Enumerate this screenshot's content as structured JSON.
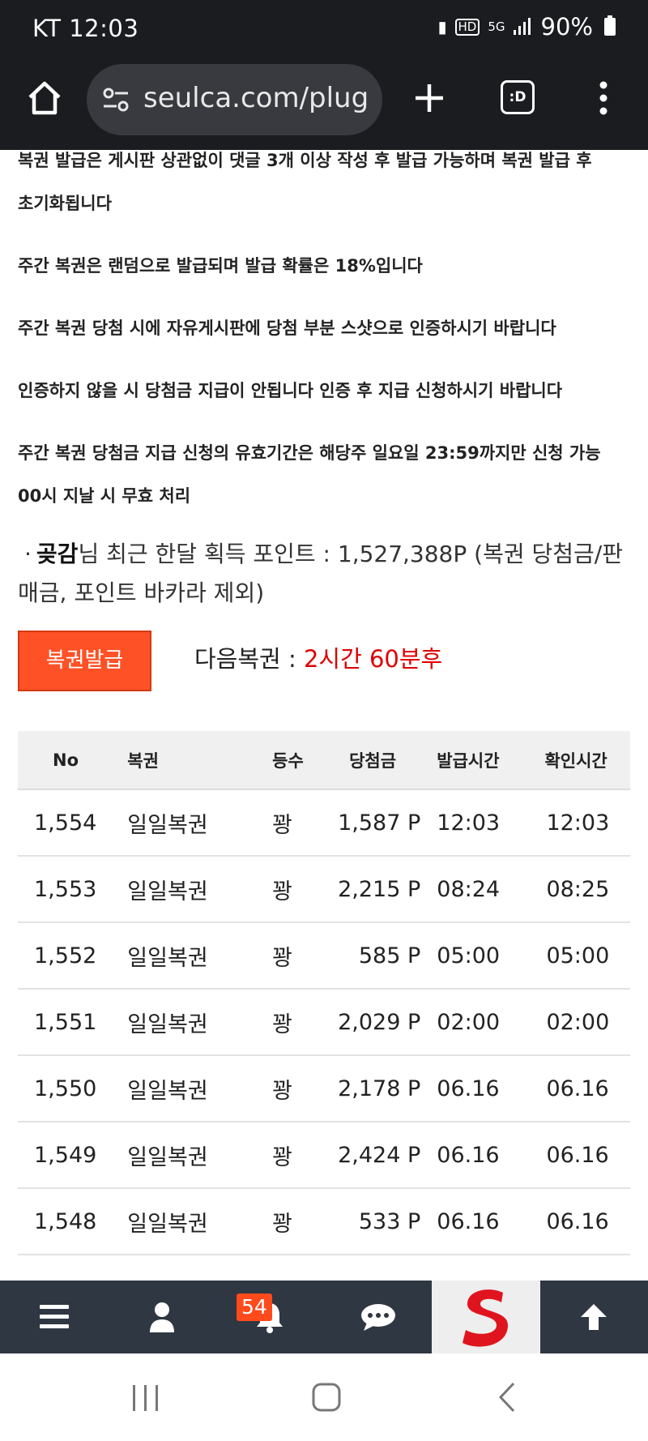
{
  "status_bar": {
    "carrier_time": "KT 12:03",
    "network": "5G",
    "battery": "90%"
  },
  "browser": {
    "url": "seulca.com/plug",
    "tabs_label": ":D"
  },
  "notices": [
    "복권 발급은 게시판 상관없이 댓글 3개 이상 작성 후 발급 가능하며 복권 발급 후",
    "초기화됩니다",
    "주간 복권은 랜덤으로 발급되며 발급 확률은 18%입니다",
    "주간 복권 당첨 시에 자유게시판에 당첨 부분 스샷으로 인증하시기 바랍니다",
    "인증하지 않을 시 당첨금 지급이 안됩니다 인증 후 지급 신청하시기 바랍니다",
    "주간 복권 당첨금 지급 신청의 유효기간은 해당주 일요일 23:59까지만 신청 가능",
    "00시 지날 시 무효 처리"
  ],
  "points": {
    "bullet": "·",
    "nickname": "곶감",
    "text_1": "님 최근 한달 획득 포인트 : 1,527,388P (복권 당첨금/판",
    "text_2": "매금, 포인트 바카라 제외)"
  },
  "issue_button_label": "복권발급",
  "next_ticket": {
    "label": "다음복권 : ",
    "value": "2시간 60분후"
  },
  "table": {
    "headers": [
      "No",
      "복권",
      "등수",
      "당첨금",
      "발급시간",
      "확인시간"
    ],
    "rows": [
      {
        "no": "1,554",
        "ticket": "일일복권",
        "rank": "꽝",
        "prize": "1,587 P",
        "issued": "12:03",
        "checked": "12:03"
      },
      {
        "no": "1,553",
        "ticket": "일일복권",
        "rank": "꽝",
        "prize": "2,215 P",
        "issued": "08:24",
        "checked": "08:25"
      },
      {
        "no": "1,552",
        "ticket": "일일복권",
        "rank": "꽝",
        "prize": "585 P",
        "issued": "05:00",
        "checked": "05:00"
      },
      {
        "no": "1,551",
        "ticket": "일일복권",
        "rank": "꽝",
        "prize": "2,029 P",
        "issued": "02:00",
        "checked": "02:00"
      },
      {
        "no": "1,550",
        "ticket": "일일복권",
        "rank": "꽝",
        "prize": "2,178 P",
        "issued": "06.16",
        "checked": "06.16"
      },
      {
        "no": "1,549",
        "ticket": "일일복권",
        "rank": "꽝",
        "prize": "2,424 P",
        "issued": "06.16",
        "checked": "06.16"
      },
      {
        "no": "1,548",
        "ticket": "일일복권",
        "rank": "꽝",
        "prize": "533 P",
        "issued": "06.16",
        "checked": "06.16"
      }
    ]
  },
  "bottom_nav": {
    "notification_count": "54",
    "items": [
      "menu-icon",
      "user-icon",
      "bell-icon",
      "chat-icon",
      "site-logo",
      "arrow-up-icon"
    ]
  },
  "colors": {
    "issue_button": "#ff5126",
    "next_ticket_value": "#e00000",
    "bottom_nav_bg": "#2f3742",
    "logo_red": "#e0141e"
  }
}
